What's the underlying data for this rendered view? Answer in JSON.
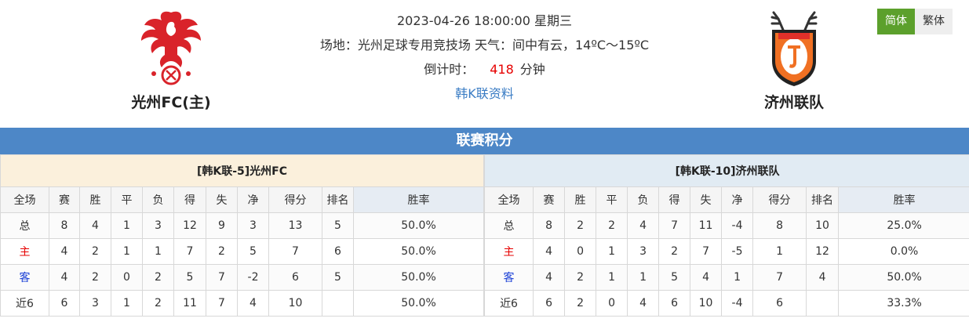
{
  "match": {
    "datetime": "2023-04-26 18:00:00 星期三",
    "venue_line": "场地：光州足球专用竞技场 天气：间中有云，14ºC～15ºC",
    "countdown_label": "倒计时：",
    "countdown_value": "418",
    "countdown_unit": "分钟",
    "league_link": "韩K联资料"
  },
  "home": {
    "name": "光州FC(主)",
    "logo_icon": "phoenix-crest-icon",
    "brand_color": "#d9232a"
  },
  "away": {
    "name": "济州联队",
    "logo_icon": "jeju-united-shield-icon",
    "brand_color": "#f07023"
  },
  "lang": {
    "simplified": "简体",
    "traditional": "繁体",
    "active_color": "#5ca02c"
  },
  "standings": {
    "title": "联赛积分",
    "headers": [
      "全场",
      "赛",
      "胜",
      "平",
      "负",
      "得",
      "失",
      "净",
      "得分",
      "排名",
      "胜率"
    ],
    "home": {
      "caption": "[韩K联-5]光州FC",
      "rows": [
        [
          "总",
          "8",
          "4",
          "1",
          "3",
          "12",
          "9",
          "3",
          "13",
          "5",
          "50.0%"
        ],
        [
          "主",
          "4",
          "2",
          "1",
          "1",
          "7",
          "2",
          "5",
          "7",
          "6",
          "50.0%"
        ],
        [
          "客",
          "4",
          "2",
          "0",
          "2",
          "5",
          "7",
          "-2",
          "6",
          "5",
          "50.0%"
        ],
        [
          "近6",
          "6",
          "3",
          "1",
          "2",
          "11",
          "7",
          "4",
          "10",
          "",
          "50.0%"
        ]
      ]
    },
    "away": {
      "caption": "[韩K联-10]济州联队",
      "rows": [
        [
          "总",
          "8",
          "2",
          "2",
          "4",
          "7",
          "11",
          "-4",
          "8",
          "10",
          "25.0%"
        ],
        [
          "主",
          "4",
          "0",
          "1",
          "3",
          "2",
          "7",
          "-5",
          "1",
          "12",
          "0.0%"
        ],
        [
          "客",
          "4",
          "2",
          "1",
          "1",
          "5",
          "4",
          "1",
          "7",
          "4",
          "50.0%"
        ],
        [
          "近6",
          "6",
          "2",
          "0",
          "4",
          "6",
          "10",
          "-4",
          "6",
          "",
          "33.3%"
        ]
      ]
    },
    "colors": {
      "header_bar": "#4d87c7",
      "home_caption_bg": "#fbf0dc",
      "away_caption_bg": "#e1ebf3",
      "home_row": "#e60000",
      "away_row": "#1a3fd6"
    }
  }
}
